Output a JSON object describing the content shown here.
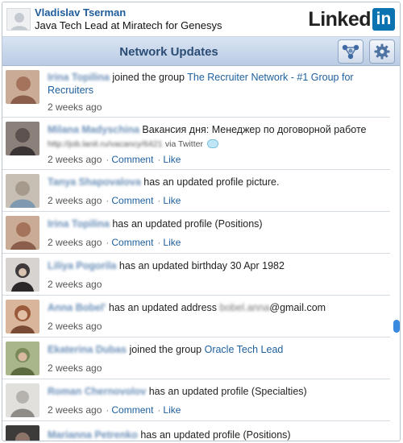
{
  "profile": {
    "name": "Vladislav Tserman",
    "headline": "Java Tech Lead at Miratech for Genesys"
  },
  "logo": {
    "text": "Linked",
    "box": "in"
  },
  "header": {
    "title": "Network Updates",
    "buttons": [
      {
        "icon": "network-icon"
      },
      {
        "icon": "gear-icon"
      }
    ]
  },
  "feed": {
    "items": [
      {
        "person": "Irina Topilina",
        "action": "joined the group",
        "link": "The Recruiter Network - #1 Group for Recruiters",
        "time": "2 weeks ago",
        "thumb_color": "#a5735b"
      },
      {
        "person": "Milana Madyschina",
        "action": "Вакансия дня: Менеджер по договорной работе",
        "url": "http://job.lanit.ru/vacancy/6421",
        "via": "via Twitter",
        "time": "2 weeks ago",
        "comment": "Comment",
        "like": "Like",
        "thumb_color": "#5d5250"
      },
      {
        "person": "Tanya Shapovalova",
        "action": "has an updated profile picture.",
        "time": "2 weeks ago",
        "comment": "Comment",
        "like": "Like",
        "thumb_color": "#a59a8c"
      },
      {
        "person": "Irina Topilina",
        "action": "has an updated profile (Positions)",
        "time": "2 weeks ago",
        "comment": "Comment",
        "like": "Like",
        "thumb_color": "#a5735b"
      },
      {
        "person": "Liliya Pogorila",
        "action": "has an updated birthday 30 Apr 1982",
        "time": "2 weeks ago",
        "thumb_color": "#3e3a3b"
      },
      {
        "person": "Anna Bobel'",
        "action": "has an updated address",
        "email_user": "bobel.anna",
        "email_domain": "@gmail.com",
        "time": "2 weeks ago",
        "thumb_color": "#9c5a3c"
      },
      {
        "person": "Ekaterina Dubas",
        "action": "joined the group",
        "link": "Oracle Tech Lead",
        "time": "2 weeks ago",
        "thumb_color": "#7a8a5a"
      },
      {
        "person": "Roman Chernovolov",
        "action": "has an updated profile (Specialties)",
        "time": "2 weeks ago",
        "comment": "Comment",
        "like": "Like",
        "thumb_color": "#b6b3ae"
      },
      {
        "person": "Marianna Petrenko",
        "action": "has an updated profile (Positions)",
        "thumb_color": "#8c7468"
      }
    ]
  },
  "colors": {
    "accent": "#1f5c9a",
    "header_bg": "#c9d8ec",
    "linkedin_blue": "#0a73b0",
    "scroll_thumb": "#3a8be0"
  }
}
